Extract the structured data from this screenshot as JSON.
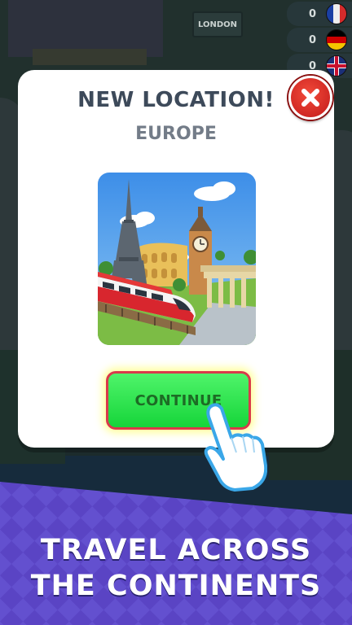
{
  "map": {
    "city_label": "LONDON"
  },
  "flags": [
    {
      "country": "France",
      "count": "0",
      "icon": "france-flag-icon"
    },
    {
      "country": "Germany",
      "count": "0",
      "icon": "germany-flag-icon"
    },
    {
      "country": "United Kingdom",
      "count": "0",
      "icon": "uk-flag-icon"
    }
  ],
  "modal": {
    "title": "NEW LOCATION!",
    "subtitle": "EUROPE",
    "continue_label": "CONTINUE",
    "close_icon": "close-icon",
    "picture": "europe-landmarks-with-train"
  },
  "banner": {
    "line1": "TRAVEL ACROSS",
    "line2": "THE CONTINENTS"
  },
  "colors": {
    "continue_green": "#2ee04e",
    "continue_border": "#d93a4a",
    "close_red": "#e23a2c",
    "banner_purple": "#5b46c7",
    "title_text": "#3d4a5a"
  }
}
